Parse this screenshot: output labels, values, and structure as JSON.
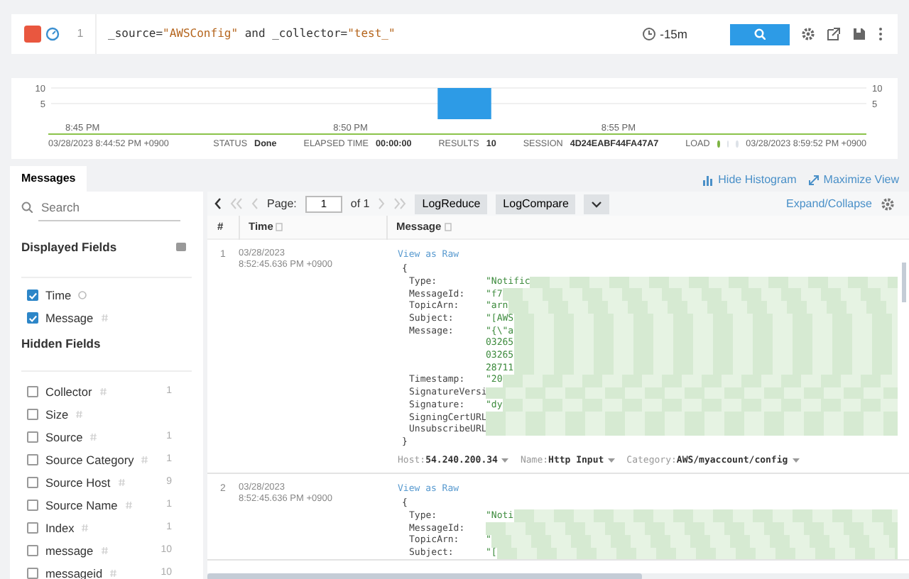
{
  "query": {
    "line_number": "1",
    "tokens": [
      {
        "text": "_source=",
        "kind": "code"
      },
      {
        "text": "\"AWSConfig\"",
        "kind": "string"
      },
      {
        "text": " and _collector=",
        "kind": "code"
      },
      {
        "text": "\"test_\"",
        "kind": "string"
      }
    ]
  },
  "time_range": "-15m",
  "histogram": {
    "chart_data": {
      "type": "bar",
      "categories": [
        "8:45 PM",
        null,
        null,
        null,
        null,
        "8:50 PM",
        null,
        null,
        null,
        null,
        "8:55 PM",
        null,
        null,
        null,
        null
      ],
      "values": [
        0,
        0,
        0,
        0,
        0,
        0,
        0,
        10,
        0,
        0,
        0,
        0,
        0,
        0,
        0
      ],
      "ylim": [
        0,
        10
      ],
      "yticks": [
        5,
        10
      ]
    },
    "right_ticks": [
      "10",
      "5"
    ]
  },
  "status_bar": {
    "start": "03/28/2023 8:44:52 PM +0900",
    "items": [
      {
        "label": "STATUS",
        "value": "Done"
      },
      {
        "label": "ELAPSED TIME",
        "value": "00:00:00"
      },
      {
        "label": "RESULTS",
        "value": "10"
      },
      {
        "label": "SESSION",
        "value": "4D24EABF44FA47A7"
      }
    ],
    "load": {
      "label": "LOAD",
      "dots": [
        {
          "on": true
        },
        {
          "on": false
        },
        {
          "on": false
        }
      ]
    },
    "end": "03/28/2023 8:59:52 PM +0900"
  },
  "tabs": [
    {
      "label": "Messages",
      "selected": true
    }
  ],
  "view_links": [
    "Hide Histogram",
    "Maximize View"
  ],
  "sidebar": {
    "search": {
      "placeholder": "Search"
    },
    "displayed_title": "Displayed Fields",
    "displayed": [
      {
        "label": "Time",
        "checked": true,
        "kind": "time"
      },
      {
        "label": "Message",
        "checked": true,
        "kind": "text"
      }
    ],
    "hidden_title": "Hidden Fields",
    "hidden": [
      {
        "label": "Collector",
        "checked": false,
        "kind": "text",
        "count": "1"
      },
      {
        "label": "Size",
        "checked": false,
        "kind": "text"
      },
      {
        "label": "Source",
        "checked": false,
        "kind": "text",
        "count": "1"
      },
      {
        "label": "Source Category",
        "checked": false,
        "kind": "text",
        "count": "1"
      },
      {
        "label": "Source Host",
        "checked": false,
        "kind": "text",
        "count": "9"
      },
      {
        "label": "Source Name",
        "checked": false,
        "kind": "text",
        "count": "1"
      },
      {
        "label": "Index",
        "checked": false,
        "kind": "text",
        "count": "1"
      },
      {
        "label": "message",
        "checked": false,
        "kind": "text",
        "count": "10"
      },
      {
        "label": "messageid",
        "checked": false,
        "kind": "text",
        "count": "10"
      }
    ]
  },
  "pager": {
    "label": "Page:",
    "value": "1",
    "total": "of 1"
  },
  "toolbar_buttons": [
    "LogReduce",
    "LogCompare"
  ],
  "expand_collapse": "Expand/Collapse",
  "columns": [
    "#",
    "Time",
    "Message"
  ],
  "rows": [
    {
      "number": "1",
      "date": "03/28/2023",
      "time": "8:52:45.636 PM +0900",
      "raw_link": "View as Raw",
      "open": "{",
      "close": "}",
      "lines": [
        {
          "key": "Type:",
          "value": "\"Notific"
        },
        {
          "key": "MessageId:",
          "value": "\"f7"
        },
        {
          "key": "TopicArn:",
          "value": "\"arn"
        },
        {
          "key": "Subject:",
          "value": "\"[AWS"
        },
        {
          "key": "Message:",
          "value": "\"{\\\"a"
        },
        {
          "value": "03265"
        },
        {
          "value": "03265"
        },
        {
          "value": "28711"
        },
        {
          "key": "Timestamp:",
          "value": "\"20"
        },
        {
          "key": "SignatureVersi"
        },
        {
          "key": "Signature:",
          "value": "\"dy"
        },
        {
          "key": "SigningCertURL"
        },
        {
          "key": "UnsubscribeURL"
        }
      ],
      "fields": [
        {
          "key": "Host:",
          "value": "54.240.200.34"
        },
        {
          "key": "Name:",
          "value": "Http Input"
        },
        {
          "key": "Category:",
          "value": "AWS/myaccount/config"
        }
      ]
    },
    {
      "number": "2",
      "date": "03/28/2023",
      "time": "8:52:45.636 PM +0900",
      "raw_link": "View as Raw",
      "open": "{",
      "lines": [
        {
          "key": "Type:",
          "value": "\"Noti"
        },
        {
          "key": "MessageId:"
        },
        {
          "key": "TopicArn:",
          "value": "\""
        },
        {
          "key": "Subject:",
          "value": "\"["
        }
      ]
    }
  ]
}
